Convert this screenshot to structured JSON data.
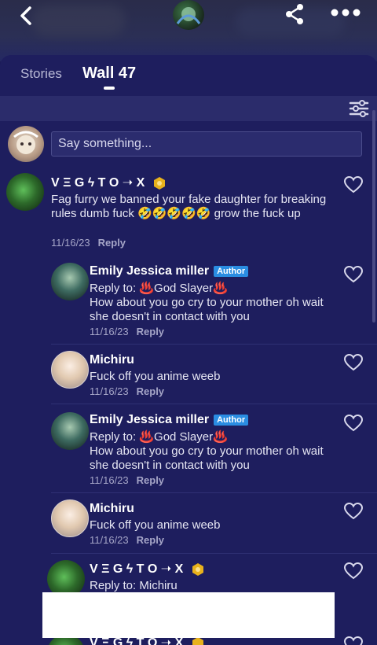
{
  "header": {
    "back_icon": "chevron-left-icon",
    "share_icon": "share-icon",
    "more_icon": "more-dots-icon"
  },
  "tabs": [
    {
      "label": "Stories",
      "active": false
    },
    {
      "label": "Wall 47",
      "active": true
    }
  ],
  "filter_icon": "sliders-icon",
  "compose": {
    "placeholder": "Say something..."
  },
  "comments": [
    {
      "author": "V Ξ G ϟ T O ➝ X",
      "badge": "level",
      "text": "Fag furry we banned your fake daughter for breaking rules dumb fuck 🤣🤣🤣🤣🤣 grow the fuck up",
      "date": "11/16/23",
      "reply_label": "Reply"
    },
    {
      "author": "Emily Jessica miller",
      "badge": "Author",
      "reply_to": "Reply to: ♨️God Slayer♨️",
      "text": "How about you go cry to your mother oh wait she doesn't in contact with you",
      "date": "11/16/23",
      "reply_label": "Reply"
    },
    {
      "author": "Michiru",
      "text": "Fuck off you anime weeb",
      "date": "11/16/23",
      "reply_label": "Reply"
    },
    {
      "author": "Emily Jessica miller",
      "badge": "Author",
      "reply_to": "Reply to: ♨️God Slayer♨️",
      "text": "How about you go cry to your mother oh wait she doesn't in contact with you",
      "date": "11/16/23",
      "reply_label": "Reply"
    },
    {
      "author": "Michiru",
      "text": "Fuck off you anime weeb",
      "date": "11/16/23",
      "reply_label": "Reply"
    },
    {
      "author": "V Ξ G ϟ T O ➝ X",
      "badge": "level",
      "reply_to": "Reply to: Michiru"
    },
    {
      "author": "V Ξ G ϟ T O ➝ X",
      "badge": "level"
    }
  ],
  "colors": {
    "background": "#1c1c58",
    "author_badge": "#2a8de2",
    "level_badge": "#e8b21c"
  }
}
